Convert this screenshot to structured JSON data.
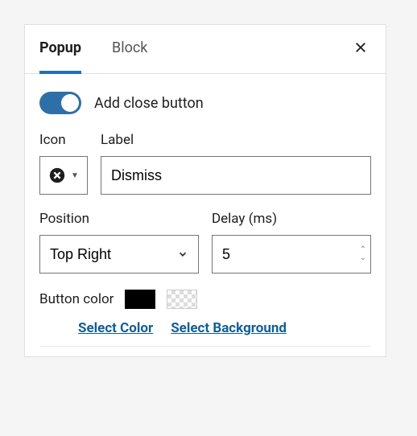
{
  "tabs": {
    "popup": "Popup",
    "block": "Block"
  },
  "close": {
    "toggle_label": "Add close button"
  },
  "fields": {
    "icon_label": "Icon",
    "label_label": "Label",
    "label_value": "Dismiss",
    "position_label": "Position",
    "position_value": "Top Right",
    "delay_label": "Delay (ms)",
    "delay_value": "5"
  },
  "color": {
    "label": "Button color",
    "select_color": "Select Color",
    "select_background": "Select Background"
  }
}
